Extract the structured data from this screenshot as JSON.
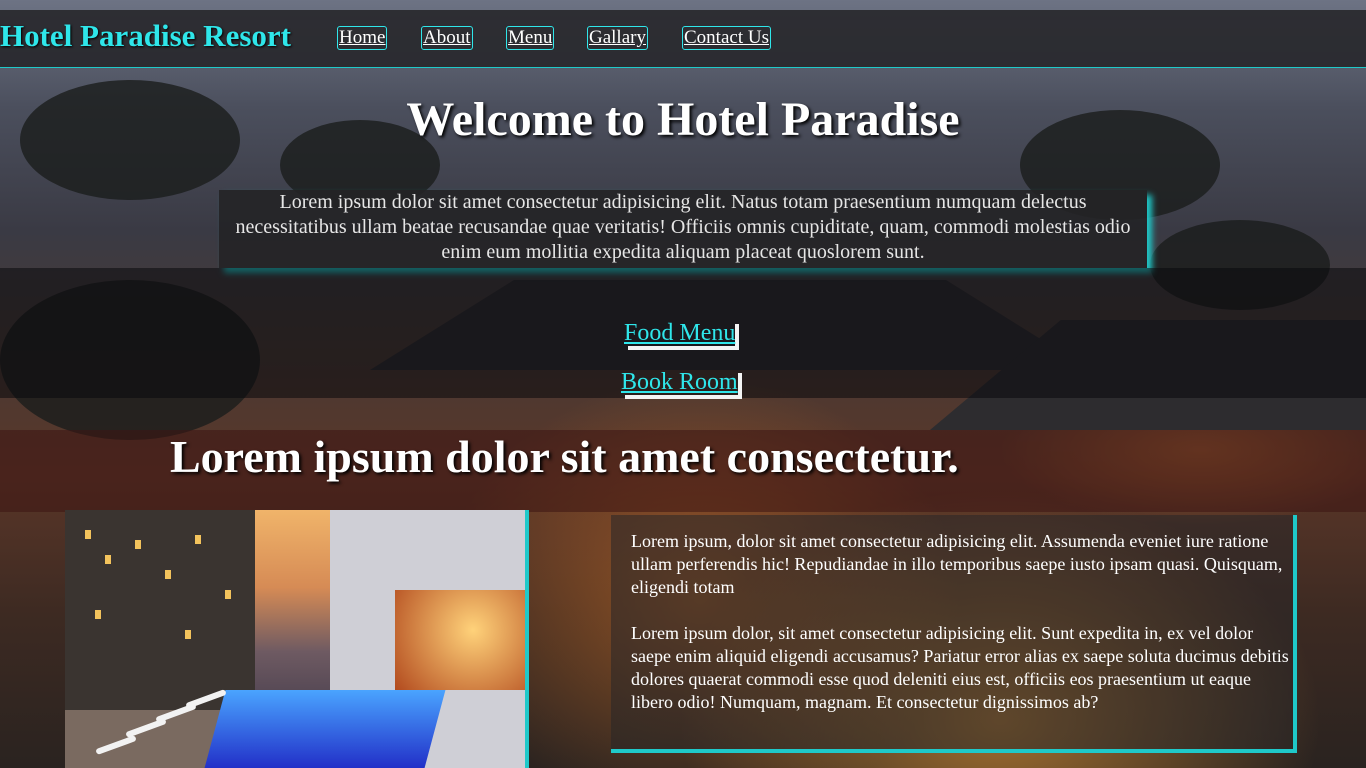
{
  "brand": "Hotel Paradise Resort",
  "nav": {
    "items": [
      {
        "label": "Home"
      },
      {
        "label": "About"
      },
      {
        "label": "Menu"
      },
      {
        "label": "Gallary"
      },
      {
        "label": "Contact Us"
      }
    ]
  },
  "hero": {
    "title": "Welcome to Hotel Paradise",
    "text": "Lorem ipsum dolor sit amet consectetur adipisicing elit. Natus totam praesentium numquam delectus necessitatibus ullam beatae recusandae quae veritatis! Officiis omnis cupiditate, quam, commodi molestias odio enim eum mollitia expedita aliquam placeat quoslorem sunt.",
    "food_menu": "Food Menu",
    "book_room": "Book Room"
  },
  "section": {
    "title": "Lorem ipsum dolor sit amet consectetur.",
    "paragraph1": "Lorem ipsum, dolor sit amet consectetur adipisicing elit. Assumenda eveniet iure ratione ullam perferendis hic! Repudiandae in illo temporibus saepe iusto ipsam quasi. Quisquam, eligendi totam",
    "paragraph2": "Lorem ipsum dolor, sit amet consectetur adipisicing elit. Sunt expedita in, ex vel dolor saepe enim aliquid eligendi accusamus? Pariatur error alias ex saepe soluta ducimus debitis dolores quaerat commodi esse quod deleniti eius est, officiis eos praesentium ut eaque libero odio! Numquam, magnam. Et consectetur dignissimos ab?"
  },
  "colors": {
    "accent": "#2fe6ea",
    "navbar": "#28282c"
  }
}
